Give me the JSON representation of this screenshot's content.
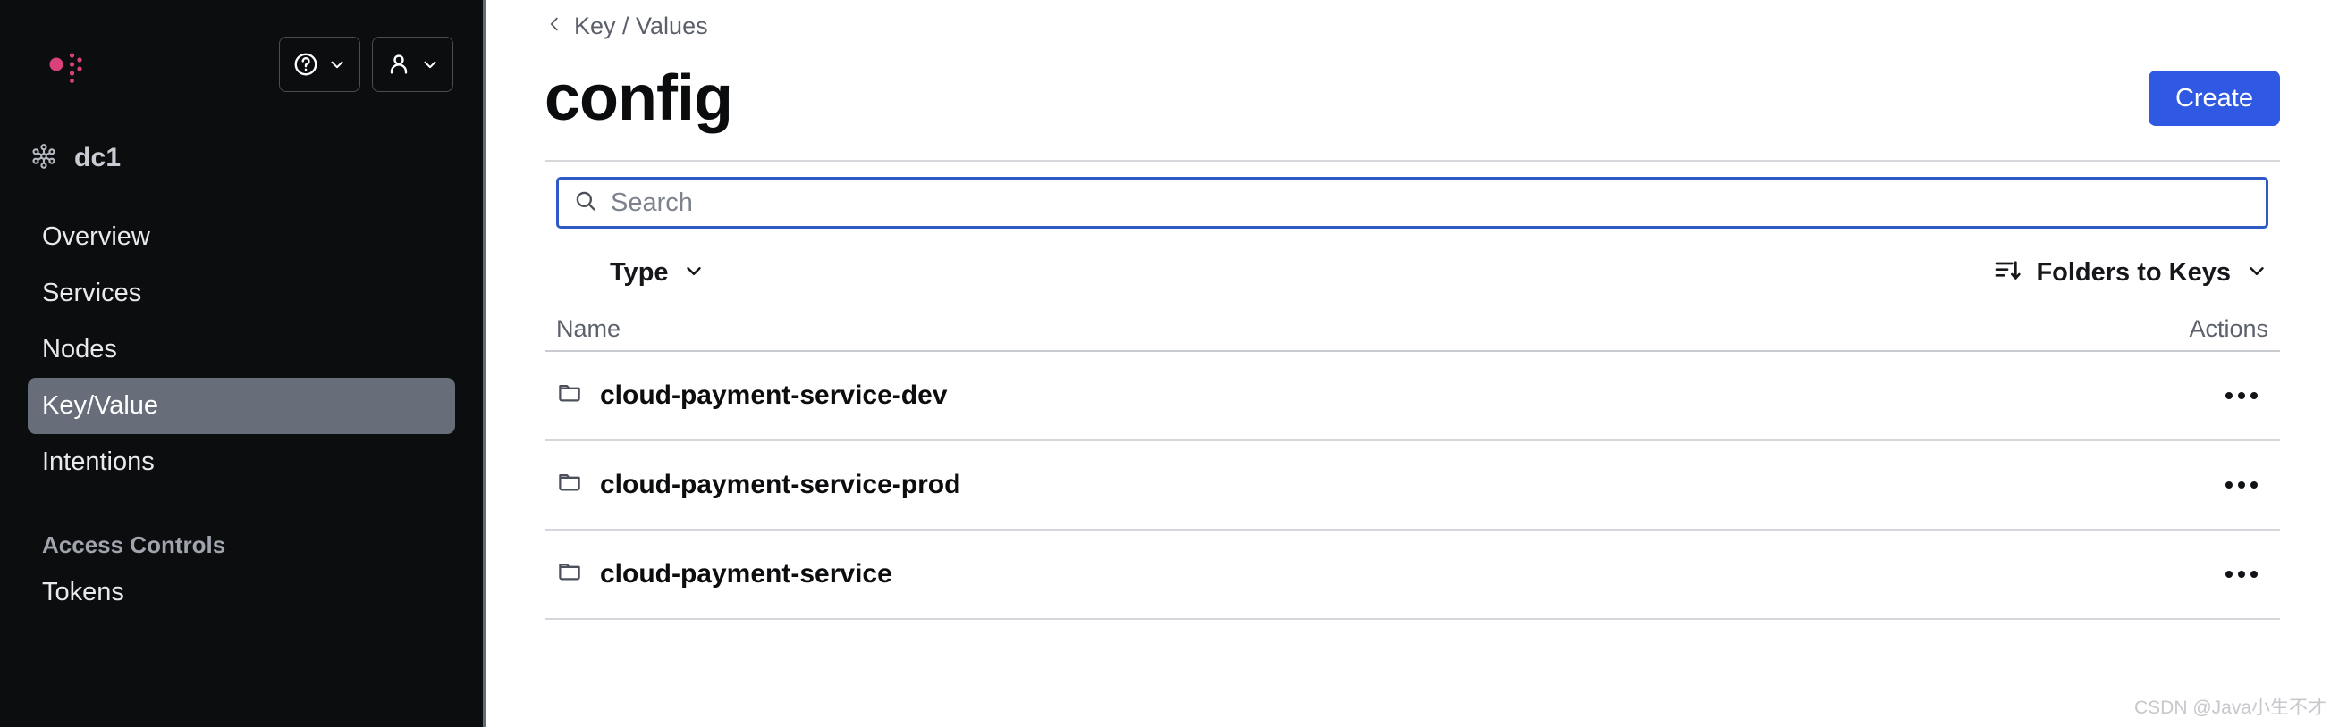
{
  "sidebar": {
    "logo_icon": "consul-logo",
    "logo_color": "#D9417B",
    "help_button": {
      "icon": "help-circle-icon",
      "chevron": "chevron-down-icon"
    },
    "user_button": {
      "icon": "user-icon",
      "chevron": "chevron-down-icon"
    },
    "datacenter": {
      "icon": "datacenter-nodes-icon",
      "label": "dc1"
    },
    "items": [
      {
        "label": "Overview",
        "active": false
      },
      {
        "label": "Services",
        "active": false
      },
      {
        "label": "Nodes",
        "active": false
      },
      {
        "label": "Key/Value",
        "active": true
      },
      {
        "label": "Intentions",
        "active": false
      }
    ],
    "section_label": "Access Controls",
    "section_items": [
      {
        "label": "Tokens",
        "active": false
      }
    ],
    "active_bg": "#676D79",
    "background": "#0C0D0F"
  },
  "main": {
    "breadcrumb": {
      "icon": "chevron-left-icon",
      "label": "Key / Values"
    },
    "page_title": "config",
    "create_button": {
      "label": "Create",
      "color": "#3059E3"
    },
    "search": {
      "icon": "search-icon",
      "placeholder": "Search",
      "value": "",
      "focus_color": "#2F5AC6"
    },
    "filter": {
      "label": "Type",
      "chevron": "chevron-down-icon"
    },
    "sort": {
      "icon": "sort-descending-icon",
      "label": "Folders to Keys",
      "chevron": "chevron-down-icon"
    },
    "table": {
      "columns": [
        "Name",
        "Actions"
      ],
      "rows": [
        {
          "icon": "folder-icon",
          "name": "cloud-payment-service-dev",
          "actions_icon": "more-horizontal-icon"
        },
        {
          "icon": "folder-icon",
          "name": "cloud-payment-service-prod",
          "actions_icon": "more-horizontal-icon"
        },
        {
          "icon": "folder-icon",
          "name": "cloud-payment-service",
          "actions_icon": "more-horizontal-icon"
        }
      ]
    }
  },
  "watermark": "CSDN @Java小生不才"
}
